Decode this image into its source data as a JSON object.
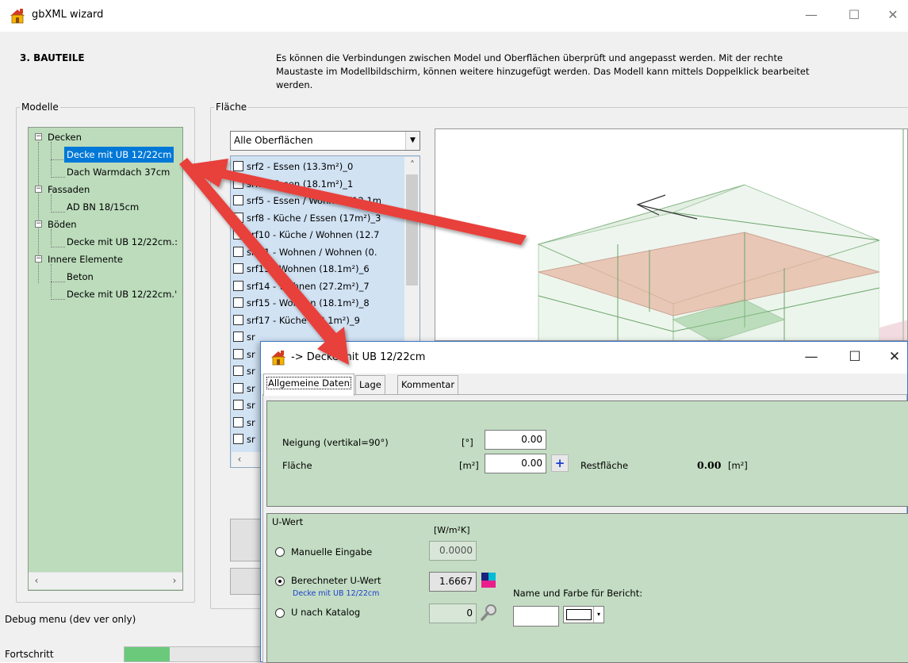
{
  "window": {
    "title": "gbXML wizard",
    "minimize_glyph": "—",
    "maximize_glyph": "☐",
    "close_glyph": "✕"
  },
  "step": {
    "title": "3.  BAUTEILE",
    "description": "Es können die Verbindungen zwischen Model und Oberflächen überprüft und angepasst werden. Mit der rechte Maustaste im Modellbildschirm, können weitere hinzugefügt werden. Das Modell kann mittels Doppelklick bearbeitet werden."
  },
  "modelle": {
    "legend": "Modelle",
    "tree": [
      {
        "label": "Decken",
        "level": 0
      },
      {
        "label": "Decke mit UB 12/22cm",
        "level": 1,
        "selected": true
      },
      {
        "label": "Dach Warmdach 37cm",
        "level": 1
      },
      {
        "label": "Fassaden",
        "level": 0
      },
      {
        "label": "AD BN 18/15cm",
        "level": 1
      },
      {
        "label": "Böden",
        "level": 0
      },
      {
        "label": "Decke mit UB 12/22cm.:",
        "level": 1
      },
      {
        "label": "Innere Elemente",
        "level": 0
      },
      {
        "label": "Beton",
        "level": 1
      },
      {
        "label": "Decke mit UB 12/22cm.'",
        "level": 1
      }
    ],
    "expander_glyph": "−"
  },
  "flaeche": {
    "legend": "Fläche",
    "combo_value": "Alle Oberflächen",
    "surfaces": [
      "srf2 - Essen (13.3m²)_0",
      "srf3 - Essen (18.1m²)_1",
      "srf5 - Essen / Wohnen (12.1m",
      "srf8 - Küche / Essen (17m²)_3",
      "srf10 - Küche / Wohnen (12.7",
      "srf11 - Wohnen / Wohnen (0.",
      "srf13 - Wohnen (18.1m²)_6",
      "srf14 - Wohnen (27.2m²)_7",
      "srf15 - Wohnen (18.1m²)_8",
      "srf17 - Küche (18.1m²)_9",
      "sr",
      "sr",
      "sr",
      "sr",
      "sr",
      "sr",
      "sr"
    ]
  },
  "debug_label": "Debug menu (dev ver only)",
  "progress": {
    "label": "Fortschritt",
    "value": 0.33
  },
  "dialog": {
    "title": "-> Decke mit UB 12/22cm",
    "tabs": [
      "Allgemeine Daten",
      "Lage",
      "Kommentar"
    ],
    "neigung_label": "Neigung  (vertikal=90°)",
    "neigung_unit": "[°]",
    "neigung_value": "0.00",
    "flaeche_label": "Fläche",
    "flaeche_unit": "[m²]",
    "flaeche_value": "0.00",
    "plus_glyph": "+",
    "restflaeche_label": "Restfläche",
    "restflaeche_value": "0.00",
    "restflaeche_unit": "[m²]",
    "uwert_legend": "U-Wert",
    "uwert_unit": "[W/m²K]",
    "manuelle_label": "Manuelle Eingabe",
    "manuelle_value": "0.0000",
    "berechnet_label": "Berechneter U-Wert",
    "berechnet_value": "1.6667",
    "berechnet_sub": "Decke mit UB 12/22cm",
    "katalog_label": "U nach Katalog",
    "katalog_value": "0",
    "bericht_label": "Name und Farbe für Bericht:",
    "dropdown_glyph": "▾"
  },
  "colors": {
    "tree_bg": "#bcdcbc",
    "selection": "#0078d7",
    "list_bg": "#d1e2f3",
    "panel_bg": "#c3dcc3",
    "annotation_arrow": "#e8413a",
    "progress": "#06b025"
  },
  "icons": {
    "app": "house-icon",
    "swatch": "color-palette-icon",
    "search": "magnifier-icon"
  }
}
